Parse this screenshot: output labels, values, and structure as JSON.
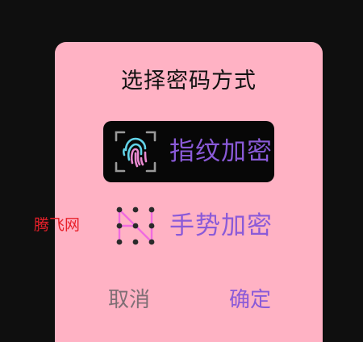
{
  "dialog": {
    "title": "选择密码方式",
    "options": [
      {
        "label": "指纹加密",
        "icon": "fingerprint-icon",
        "selected": true
      },
      {
        "label": "手势加密",
        "icon": "gesture-pattern-icon",
        "selected": false
      }
    ],
    "cancel_label": "取消",
    "confirm_label": "确定"
  },
  "watermark": "腾飞网",
  "colors": {
    "screen_bg": "#0f0f0f",
    "dialog_bg": "#ffb2c4",
    "accent_purple": "#8a5ad8",
    "selected_bg": "#070707",
    "cancel_text": "#7f6f75",
    "watermark_red": "#e8202a"
  }
}
